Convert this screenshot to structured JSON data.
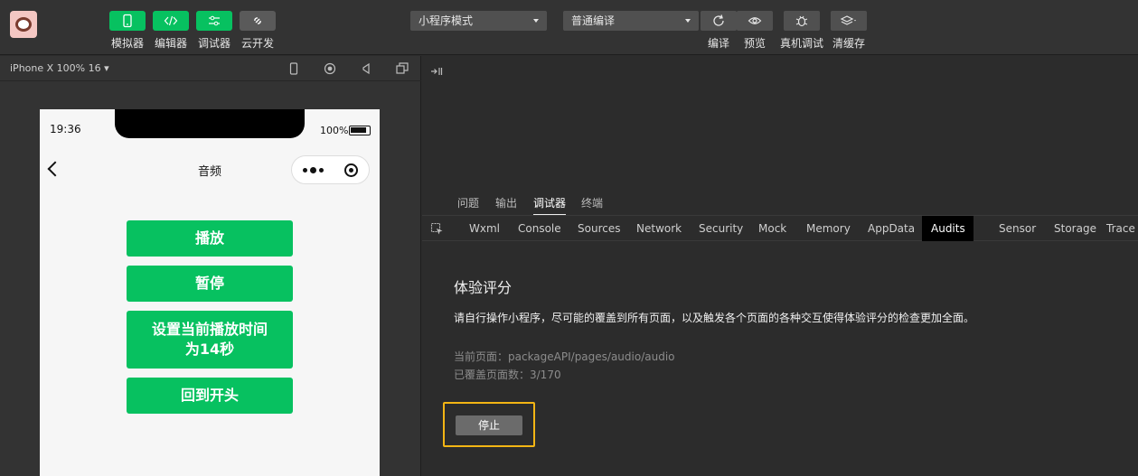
{
  "toolbar": {
    "simulator_label": "模拟器",
    "editor_label": "编辑器",
    "debugger_label": "调试器",
    "cloud_label": "云开发",
    "mode_select": "小程序模式",
    "compile_select": "普通编译",
    "compile_label": "编译",
    "preview_label": "预览",
    "remote_debug_label": "真机调试",
    "clear_cache_label": "清缓存",
    "accent_color": "#07c160"
  },
  "simulator": {
    "device_label": "iPhone X 100% 16 ▾",
    "time": "19:36",
    "battery": "100%",
    "page_title": "音频",
    "buttons": [
      "播放",
      "暂停",
      "设置当前播放时间\n为14秒",
      "回到开头"
    ]
  },
  "devtools": {
    "top_tabs": [
      "问题",
      "输出",
      "调试器",
      "终端"
    ],
    "active_top_tab": "调试器",
    "panel_tabs": [
      "Wxml",
      "Console",
      "Sources",
      "Network",
      "Security",
      "Mock",
      "Memory",
      "AppData",
      "Audits",
      "Sensor",
      "Storage",
      "Trace"
    ],
    "active_panel_tab": "Audits",
    "audits": {
      "title": "体验评分",
      "description": "请自行操作小程序，尽可能的覆盖到所有页面，以及触发各个页面的各种交互使得体验评分的检查更加全面。",
      "current_page": "当前页面：packageAPI/pages/audio/audio",
      "covered_pages": "已覆盖页面数：3/170",
      "stop_label": "停止",
      "highlight_color": "#f3b514"
    }
  }
}
